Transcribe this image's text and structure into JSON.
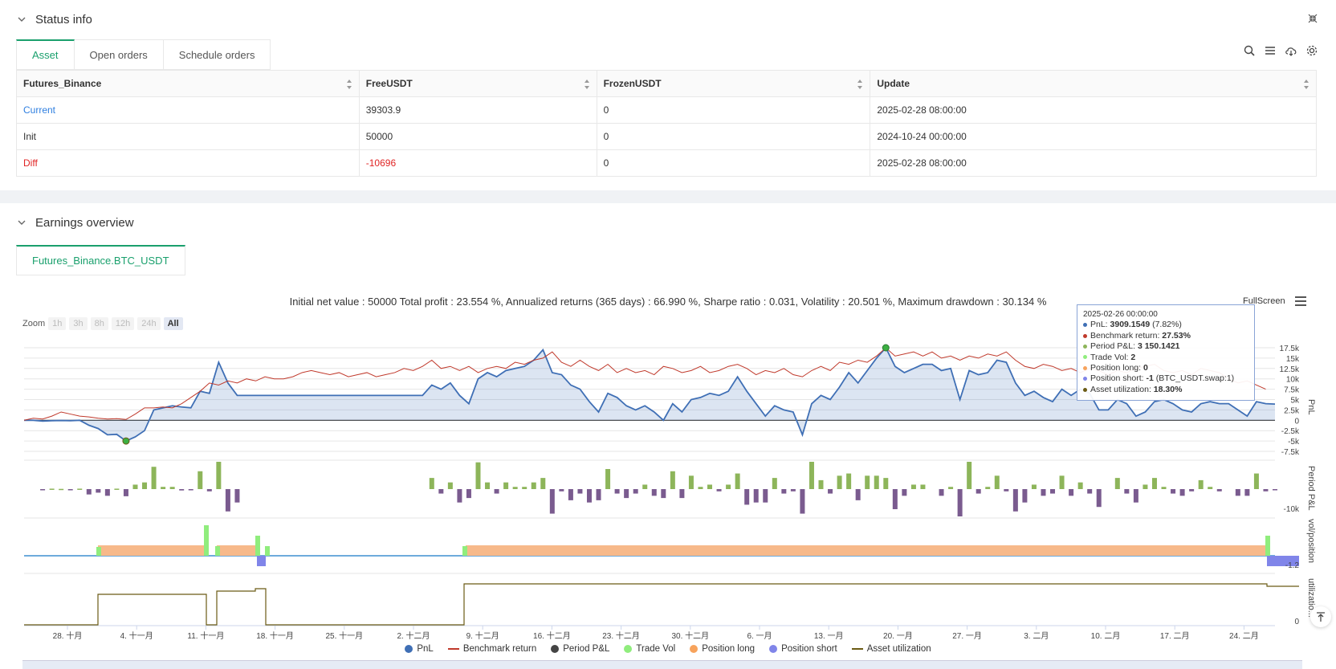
{
  "status_panel": {
    "title": "Status info",
    "tabs": [
      "Asset",
      "Open orders",
      "Schedule orders"
    ],
    "table": {
      "headers": [
        "Futures_Binance",
        "FreeUSDT",
        "FrozenUSDT",
        "Update"
      ],
      "rows": [
        [
          "Current",
          "39303.9",
          "0",
          "2025-02-28 08:00:00"
        ],
        [
          "Init",
          "50000",
          "0",
          "2024-10-24 00:00:00"
        ],
        [
          "Diff",
          "-10696",
          "0",
          "2025-02-28 08:00:00"
        ]
      ]
    },
    "toolbar_icons": [
      "search-icon",
      "list-icon",
      "cloud-download-icon",
      "gear-icon"
    ]
  },
  "earnings_panel": {
    "title": "Earnings overview",
    "tab": "Futures_Binance.BTC_USDT",
    "summary": "Initial net value : 50000 Total profit : 23.554 %, Annualized returns (365 days) : 66.990 %, Sharpe ratio : 0.031, Volatility : 20.501 %, Maximum drawdown : 30.134 %",
    "zoom_label": "Zoom",
    "zoom_buttons": [
      "1h",
      "3h",
      "8h",
      "12h",
      "24h",
      "All"
    ],
    "zoom_active": "All",
    "fullscreen_label": "FullScreen"
  },
  "tooltip": {
    "date": "2025-02-26 00:00:00",
    "lines": [
      {
        "label": "PnL: ",
        "value": "3909.1549",
        "extra": " (7.82%)",
        "color": "#3f6fb5"
      },
      {
        "label": "Benchmark return: ",
        "value": "27.53%",
        "extra": "",
        "color": "#c0392b"
      },
      {
        "label": "Period P&L: ",
        "value": "3 150.1421",
        "extra": "",
        "color": "#8db55a"
      },
      {
        "label": "Trade Vol: ",
        "value": "2",
        "extra": "",
        "color": "#90ed7d"
      },
      {
        "label": "Position long: ",
        "value": "0",
        "extra": "",
        "color": "#f7a35c"
      },
      {
        "label": "Position short: ",
        "value": "-1",
        "extra": " (BTC_USDT.swap:1)",
        "color": "#8085e9"
      },
      {
        "label": "Asset utilization: ",
        "value": "18.30%",
        "extra": "",
        "color": "#6b5b14"
      }
    ]
  },
  "legend": [
    {
      "name": "PnL",
      "color": "#3f6fb5",
      "kind": "dot"
    },
    {
      "name": "Benchmark return",
      "color": "#c0392b",
      "kind": "line"
    },
    {
      "name": "Period P&L",
      "color": "#444444",
      "kind": "dot"
    },
    {
      "name": "Trade Vol",
      "color": "#90ed7d",
      "kind": "dot"
    },
    {
      "name": "Position long",
      "color": "#f7a35c",
      "kind": "dot"
    },
    {
      "name": "Position short",
      "color": "#8085e9",
      "kind": "dot"
    },
    {
      "name": "Asset utilization",
      "color": "#6b5b14",
      "kind": "line"
    }
  ],
  "chart_data": {
    "type": "line",
    "x_ticks": [
      "28. 十月",
      "4. 十一月",
      "11. 十一月",
      "18. 十一月",
      "25. 十一月",
      "2. 十二月",
      "9. 十二月",
      "16. 十二月",
      "23. 十二月",
      "30. 十二月",
      "6. 一月",
      "13. 一月",
      "20. 一月",
      "27. 一月",
      "3. 二月",
      "10. 二月",
      "17. 二月",
      "24. 二月"
    ],
    "pnl_axis": {
      "label": "PnL",
      "ticks": [
        "17.5k",
        "15k",
        "12.5k",
        "10k",
        "7.5k",
        "5k",
        "2.5k",
        "0",
        "-2.5k",
        "-5k",
        "-7.5k"
      ],
      "ylim": [
        -7500,
        17500
      ]
    },
    "period_axis": {
      "label": "Period P&L",
      "ticks": [
        "-10k"
      ]
    },
    "vol_axis": {
      "label": "vol/position",
      "ticks": [
        "-1.2"
      ]
    },
    "util_axis": {
      "label": "utilizatio...",
      "ticks": [
        "0"
      ]
    },
    "pnl": [
      0,
      0,
      -200,
      -100,
      -50,
      -100,
      0,
      -1200,
      -2000,
      -3500,
      -3400,
      -5000,
      -4000,
      -2500,
      2500,
      3000,
      3500,
      3200,
      3000,
      7000,
      6500,
      14000,
      9000,
      6000,
      6000,
      6000,
      6000,
      6000,
      6000,
      6000,
      6000,
      6000,
      6000,
      6000,
      6000,
      6000,
      6000,
      6000,
      6000,
      6000,
      6000,
      6000,
      6000,
      6000,
      8500,
      7500,
      9000,
      6000,
      4000,
      10000,
      11500,
      10500,
      12000,
      12500,
      13000,
      14500,
      17000,
      11500,
      11000,
      8500,
      7500,
      4500,
      2000,
      6500,
      5500,
      3500,
      2500,
      3500,
      2000,
      0,
      4000,
      2000,
      5000,
      5500,
      6500,
      6000,
      7000,
      10500,
      7000,
      4000,
      1000,
      3500,
      2500,
      2000,
      -3500,
      4000,
      6000,
      5000,
      8000,
      11500,
      9000,
      12000,
      15000,
      17500,
      13000,
      11500,
      12500,
      13500,
      13500,
      12000,
      12500,
      5000,
      12000,
      11000,
      11500,
      14500,
      14000,
      9000,
      6000,
      7000,
      5500,
      4500,
      7500,
      6000,
      7500,
      6500,
      2500,
      2500,
      5000,
      4000,
      1000,
      2000,
      4500,
      5000,
      4000,
      2500,
      2000,
      4000,
      4500,
      4000,
      4000,
      2500,
      1000,
      4500,
      4000,
      3909
    ],
    "benchmark": [
      0,
      500,
      300,
      1000,
      2000,
      1500,
      1000,
      800,
      500,
      300,
      400,
      200,
      1500,
      3000,
      3000,
      3200,
      3000,
      4000,
      5500,
      7000,
      9000,
      8500,
      9500,
      9000,
      10000,
      9500,
      10500,
      10000,
      10000,
      10500,
      11500,
      12000,
      11500,
      11000,
      11500,
      10500,
      11000,
      11500,
      10500,
      11000,
      11500,
      12500,
      12000,
      13000,
      14500,
      12500,
      13000,
      12000,
      13000,
      11500,
      12500,
      13000,
      12500,
      14000,
      13500,
      14500,
      15000,
      16500,
      14000,
      13000,
      14500,
      13000,
      12000,
      13500,
      11500,
      12500,
      11500,
      12000,
      11000,
      13000,
      12500,
      11500,
      12000,
      13000,
      11500,
      12000,
      13000,
      13500,
      12500,
      11000,
      12000,
      11500,
      12500,
      11000,
      10500,
      12000,
      13000,
      12000,
      14000,
      13500,
      14500,
      14000,
      15500,
      17500,
      15500,
      16000,
      16500,
      15500,
      16500,
      15000,
      15500,
      14500,
      15500,
      15000,
      16000,
      15500,
      16500,
      14500,
      13000,
      12500,
      13500,
      13000,
      12000,
      12500,
      11500,
      12500,
      12000,
      11000,
      12000,
      11500,
      12500,
      13000,
      13500,
      12000,
      11500,
      12000,
      11000,
      12500,
      12000,
      11500,
      10000,
      9000,
      9500,
      8500,
      7500
    ]
  }
}
